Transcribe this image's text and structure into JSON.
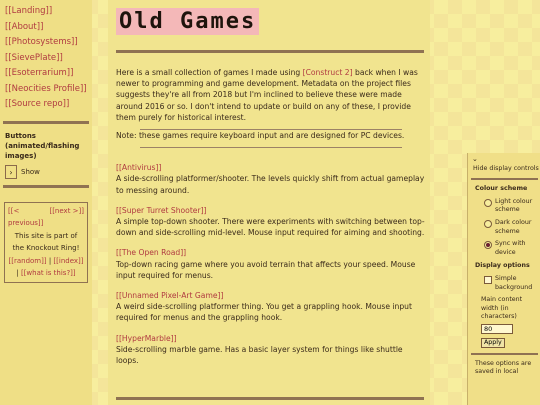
{
  "sidebar": {
    "links": [
      "[[Landing]]",
      "[[About]]",
      "[[Photosystems]]",
      "[[SievePlate]]",
      "[[Esoterrarium]]",
      "[[Neocities Profile]]",
      "[[Source repo]]"
    ],
    "buttons_heading": "Buttons (animated/flashing images)",
    "show_label": "Show",
    "webring": {
      "prev": "[[< previous]]",
      "next": "[[next >]]",
      "text": "This site is part of the Knockout Ring!",
      "random": "[[random]]",
      "index": "[[index]]",
      "what": "[[what is this?]]"
    }
  },
  "main": {
    "title": "Old Games",
    "intro_before": "Here is a small collection of games I made using ",
    "intro_link": "[Construct 2]",
    "intro_after": " back when I was newer to programming and game development. Metadata on the project files suggests they're all from 2018 but I'm inclined to believe these were made around 2016 or so. I don't intend to update or build on any of these, I provide them purely for historical interest.",
    "note": "Note: these games require keyboard input and are designed for PC devices.",
    "games": [
      {
        "name": "[[Antivirus]]",
        "desc": "A side-scrolling platformer/shooter. The levels quickly shift from actual gameplay to messing around."
      },
      {
        "name": "[[Super Turret Shooter]]",
        "desc": "A simple top-down shooter. There were experiments with switching between top-down and side-scrolling mid-level. Mouse input required for aiming and shooting."
      },
      {
        "name": "[[The Open Road]]",
        "desc": "Top-down racing game where you avoid terrain that affects your speed. Mouse input required for menus."
      },
      {
        "name": "[[Unnamed Pixel-Art Game]]",
        "desc": "A weird side-scrolling platformer thing. You get a grappling hook. Mouse input required for menus and the grappling hook."
      },
      {
        "name": "[[HyperMarble]]",
        "desc": "Side-scrolling marble game. Has a basic layer system for things like shuttle loops."
      }
    ]
  },
  "panel": {
    "hide_label": "Hide display controls",
    "colour_scheme": "Colour scheme",
    "light": "Light colour scheme",
    "dark": "Dark colour scheme",
    "sync": "Sync with device",
    "display_options": "Display options",
    "simple_bg": "Simple background",
    "width_label": "Main content width (in characters)",
    "width_value": "80",
    "apply": "Apply",
    "footer": "These options are saved in local"
  }
}
